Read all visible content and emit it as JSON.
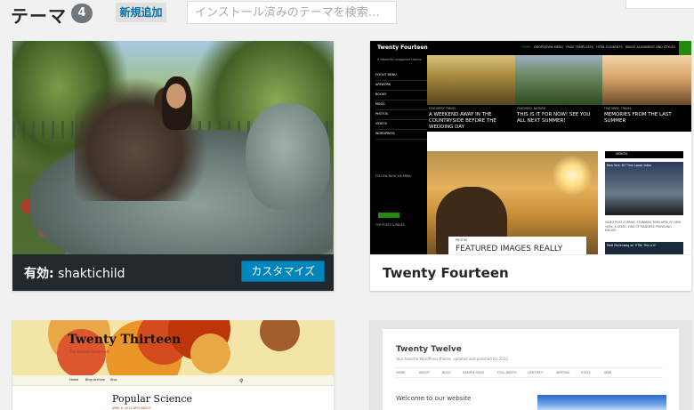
{
  "header": {
    "title": "テーマ",
    "count": "4",
    "add_new_label": "新規追加",
    "search_placeholder": "インストール済みのテーマを検索…"
  },
  "themes": [
    {
      "active_prefix": "有効:",
      "name": "shaktichild",
      "customize_label": "カスタマイズ"
    },
    {
      "name": "Twenty Fourteen",
      "preview": {
        "site_title": "Twenty Fourteen",
        "tagline": "A beautiful magazine theme",
        "nav": [
          "HOME",
          "DROPDOWN MENU",
          "PAGE TEMPLATES",
          "HTML ELEMENTS",
          "IMAGE ALIGNMENT AND STYLES"
        ],
        "menu": [
          "FLYOUT MENU",
          "ARTWORK",
          "BOOKS",
          "MUSIC",
          "PHOTOS",
          "VIDEOS",
          "WORDPRESS"
        ],
        "featured": [
          {
            "label": "FEATURED, TRAVEL",
            "title": "A WEEKEND AWAY IN THE COUNTRYSIDE BEFORE THE WEDDING DAY"
          },
          {
            "label": "FEATURED, NATURE",
            "title": "THIS IS IT FOR NOW! SEE YOU ALL NEXT SUMMER!"
          },
          {
            "label": "FEATURED, TRAVEL",
            "title": "MEMORIES FROM THE LAST SUMMER"
          }
        ],
        "follow_title": "FOLLOW BLOG VIA EMAIL",
        "follow_button": "FOLLOW",
        "top_posts_title": "TOP POSTS & PAGES",
        "main_label": "PHOTOS",
        "main_title": "FEATURED IMAGES REALLY",
        "widget_title": "VIDEOS",
        "video_title": "New York: NY Time Lapse video",
        "video_caption": "VIDEO POST FORMAT: STUNNING TIMELAPSE OF NEW YORK, A STATIC KIND OF MADNESS PROVIDING EAGLES",
        "video2_title": "Matt Mullenweg on 'ETW: This is It'"
      }
    },
    {
      "name": "Twenty Thirteen",
      "preview": {
        "site_title": "Twenty Thirteen",
        "tagline": "The Fastest Northwest",
        "nav": [
          "Home",
          "Blog Archive",
          "Also"
        ],
        "post_title": "Popular Science",
        "post_meta": "APRIL 6, 2013   ARTS   ABOUT"
      }
    },
    {
      "name": "Twenty Twelve",
      "preview": {
        "site_title": "Twenty Twelve",
        "tagline": "Your favorite WordPress theme, updated and polished for 2012.",
        "nav": [
          "HOME",
          "ABOUT",
          "BLOG",
          "SAMPLE PAGE",
          "FULL WIDTH",
          "GENTRIFY",
          "WRITING",
          "STYLE",
          "WEB"
        ],
        "welcome": "Welcome to our website"
      }
    }
  ],
  "colors": {
    "active_footer": "#23282d",
    "customize_button": "#0085ba",
    "tf_accent": "#24890d",
    "t13_accent": "#bc360a"
  }
}
